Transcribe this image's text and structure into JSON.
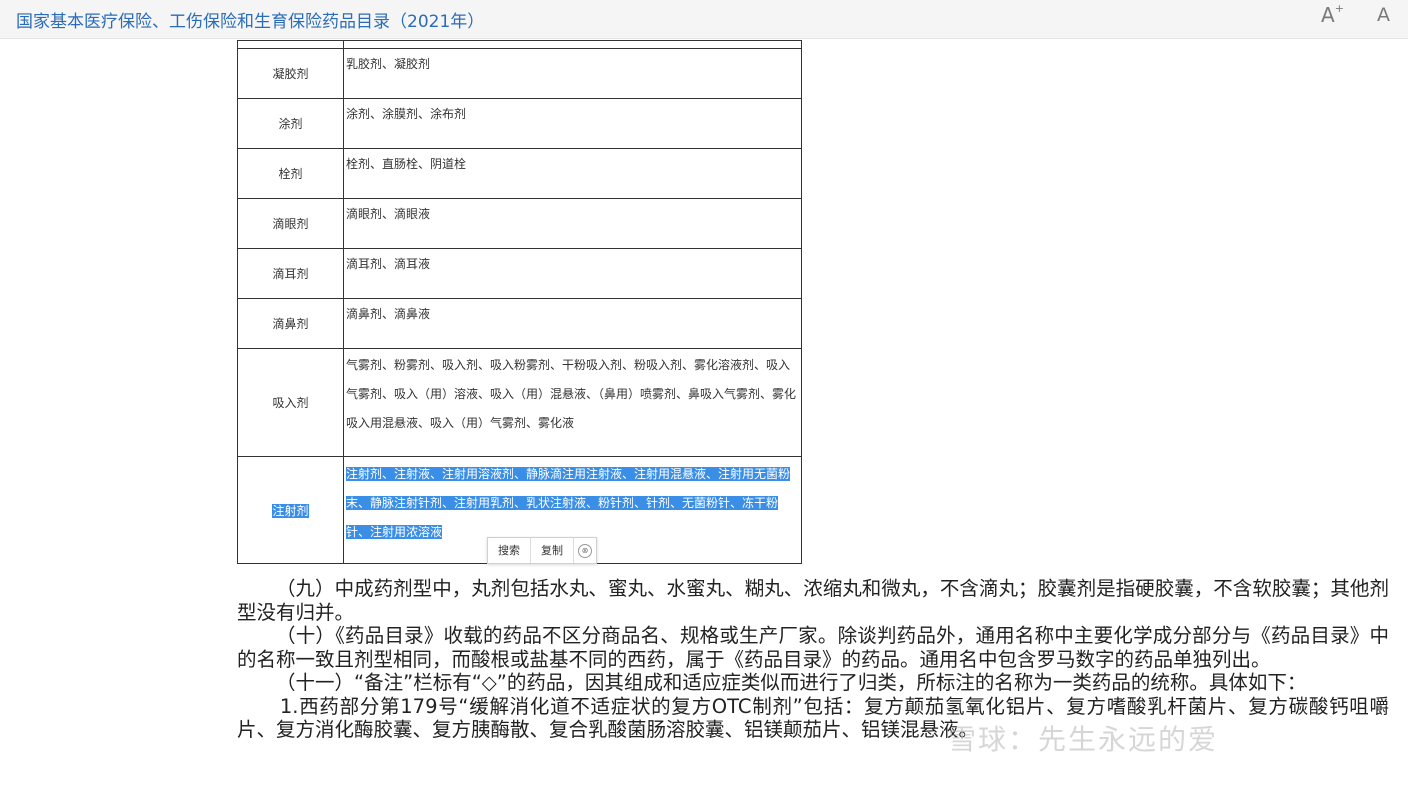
{
  "header": {
    "title": "国家基本医疗保险、工伤保险和生育保险药品目录（2021年）",
    "font_increase": "A",
    "font_increase_sup": "+",
    "font_decrease": "A"
  },
  "table": {
    "rows": [
      {
        "form": "",
        "names": ""
      },
      {
        "form": "凝胶剂",
        "names": "乳胶剂、凝胶剂"
      },
      {
        "form": "涂剂",
        "names": "涂剂、涂膜剂、涂布剂"
      },
      {
        "form": "栓剂",
        "names": "栓剂、直肠栓、阴道栓"
      },
      {
        "form": "滴眼剂",
        "names": "滴眼剂、滴眼液"
      },
      {
        "form": "滴耳剂",
        "names": "滴耳剂、滴耳液"
      },
      {
        "form": "滴鼻剂",
        "names": "滴鼻剂、滴鼻液"
      },
      {
        "form": "吸入剂",
        "names": "气雾剂、粉雾剂、吸入剂、吸入粉雾剂、干粉吸入剂、粉吸入剂、雾化溶液剂、吸入气雾剂、吸入（用）溶液、吸入（用）混悬液、（鼻用）喷雾剂、鼻吸入气雾剂、雾化吸入用混悬液、吸入（用）气雾剂、雾化液"
      },
      {
        "form": "注射剂",
        "names": "注射剂、注射液、注射用溶液剂、静脉滴注用注射液、注射用混悬液、注射用无菌粉末、静脉注射针剂、注射用乳剂、乳状注射液、粉针剂、针剂、无菌粉针、冻干粉针、注射用浓溶液"
      }
    ]
  },
  "context_menu": {
    "search": "搜索",
    "copy": "复制",
    "close_icon": "⊗"
  },
  "paragraphs": [
    "（九）中成药剂型中，丸剂包括水丸、蜜丸、水蜜丸、糊丸、浓缩丸和微丸，不含滴丸；胶囊剂是指硬胶囊，不含软胶囊；其他剂型没有归并。",
    "（十）《药品目录》收载的药品不区分商品名、规格或生产厂家。除谈判药品外，通用名称中主要化学成分部分与《药品目录》中的名称一致且剂型相同，而酸根或盐基不同的西药，属于《药品目录》的药品。通用名中包含罗马数字的药品单独列出。",
    "（十一）“备注”栏标有“◇”的药品，因其组成和适应症类似而进行了归类，所标注的名称为一类药品的统称。具体如下：",
    "1.西药部分第179号“缓解消化道不适症状的复方OTC制剂”包括：复方颠茄氢氧化铝片、复方嗜酸乳杆菌片、复方碳酸钙咀嚼片、复方消化酶胶囊、复方胰酶散、复合乳酸菌肠溶胶囊、铝镁颠茄片、铝镁混悬液。"
  ],
  "watermark": "雪球：先生永远的爱"
}
